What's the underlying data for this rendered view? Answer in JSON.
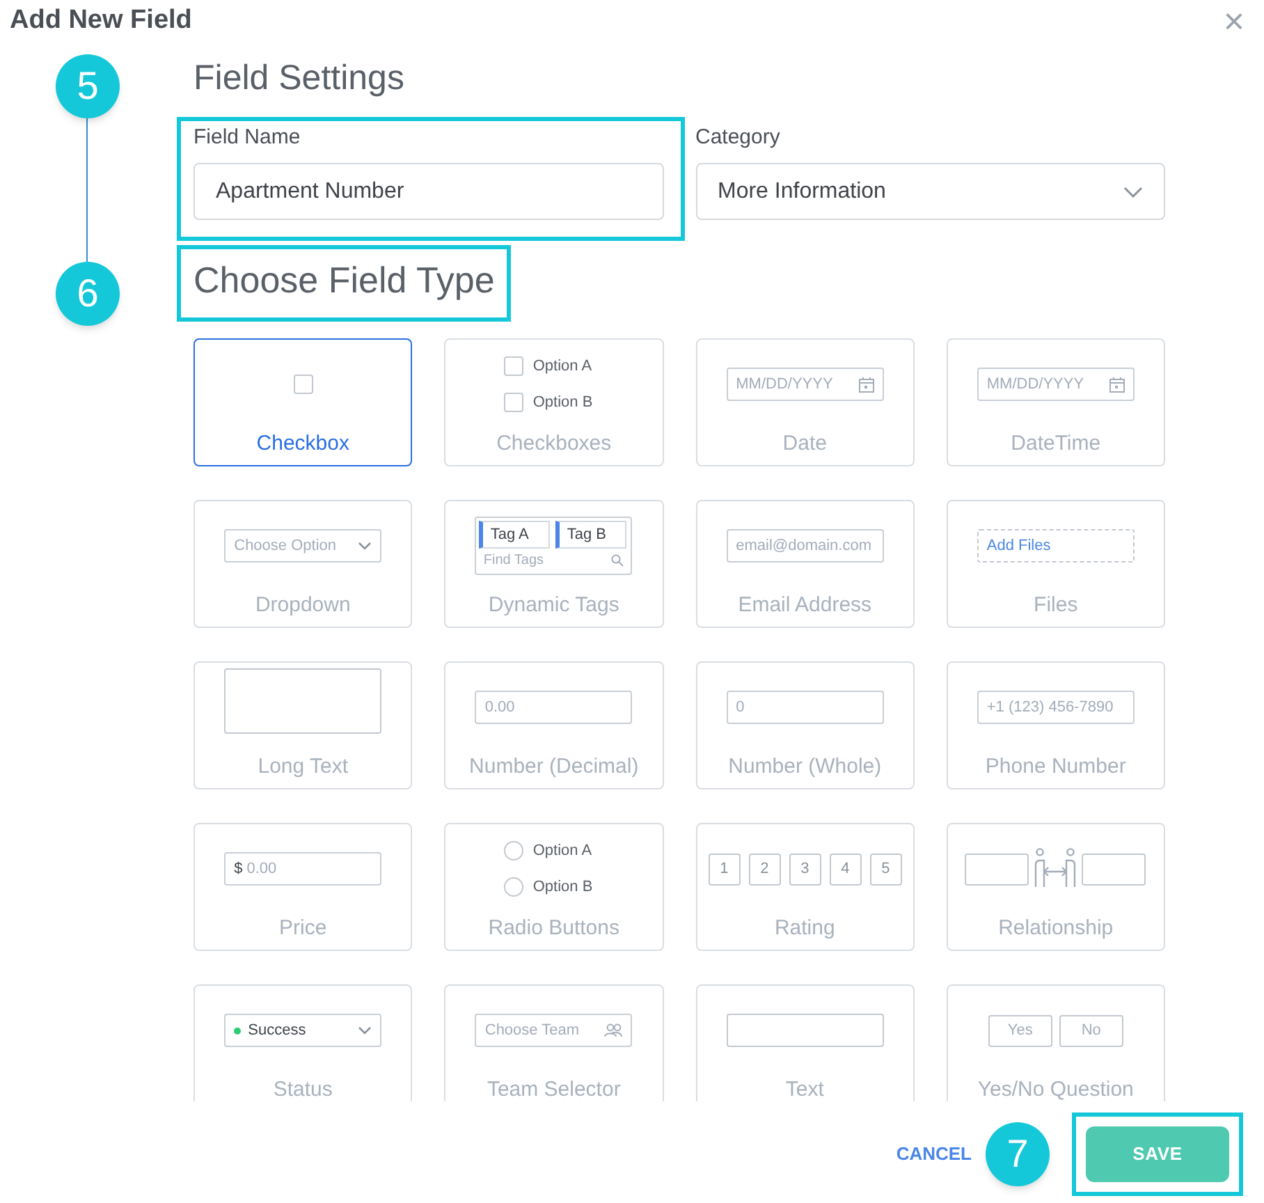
{
  "dialog": {
    "title": "Add New Field",
    "close": "×"
  },
  "steps": [
    "5",
    "6",
    "7"
  ],
  "field_settings": {
    "heading": "Field Settings",
    "field_name": {
      "label": "Field Name",
      "value": "Apartment Number"
    },
    "category": {
      "label": "Category",
      "value": "More Information"
    }
  },
  "field_type": {
    "heading": "Choose Field Type",
    "cards": [
      {
        "label": "Checkbox",
        "selected": true,
        "kind": "checkbox"
      },
      {
        "label": "Checkboxes",
        "selected": false,
        "kind": "checklist",
        "options": [
          "Option A",
          "Option B"
        ]
      },
      {
        "label": "Date",
        "selected": false,
        "kind": "date",
        "placeholder": "MM/DD/YYYY"
      },
      {
        "label": "DateTime",
        "selected": false,
        "kind": "date",
        "placeholder": "MM/DD/YYYY"
      },
      {
        "label": "Dropdown",
        "selected": false,
        "kind": "select",
        "placeholder": "Choose Option"
      },
      {
        "label": "Dynamic Tags",
        "selected": false,
        "kind": "tags",
        "tags": [
          "Tag A",
          "Tag B"
        ],
        "placeholder": "Find Tags"
      },
      {
        "label": "Email Address",
        "selected": false,
        "kind": "input",
        "placeholder": "email@domain.com"
      },
      {
        "label": "Files",
        "selected": false,
        "kind": "files",
        "placeholder": "Add Files"
      },
      {
        "label": "Long Text",
        "selected": false,
        "kind": "textarea"
      },
      {
        "label": "Number (Decimal)",
        "selected": false,
        "kind": "input",
        "placeholder": "0.00"
      },
      {
        "label": "Number (Whole)",
        "selected": false,
        "kind": "input",
        "placeholder": "0"
      },
      {
        "label": "Phone Number",
        "selected": false,
        "kind": "input",
        "placeholder": "+1 (123) 456-7890"
      },
      {
        "label": "Price",
        "selected": false,
        "kind": "price",
        "prefix": "$",
        "placeholder": "0.00"
      },
      {
        "label": "Radio Buttons",
        "selected": false,
        "kind": "radios",
        "options": [
          "Option A",
          "Option B"
        ]
      },
      {
        "label": "Rating",
        "selected": false,
        "kind": "rating",
        "options": [
          "1",
          "2",
          "3",
          "4",
          "5"
        ]
      },
      {
        "label": "Relationship",
        "selected": false,
        "kind": "relationship"
      },
      {
        "label": "Status",
        "selected": false,
        "kind": "status",
        "value": "Success",
        "color": "#2ecc71"
      },
      {
        "label": "Team Selector",
        "selected": false,
        "kind": "team",
        "placeholder": "Choose Team"
      },
      {
        "label": "Text",
        "selected": false,
        "kind": "text"
      },
      {
        "label": "Yes/No Question",
        "selected": false,
        "kind": "yesno",
        "options": [
          "Yes",
          "No"
        ]
      }
    ]
  },
  "footer": {
    "cancel": "CANCEL",
    "save": "SAVE"
  }
}
